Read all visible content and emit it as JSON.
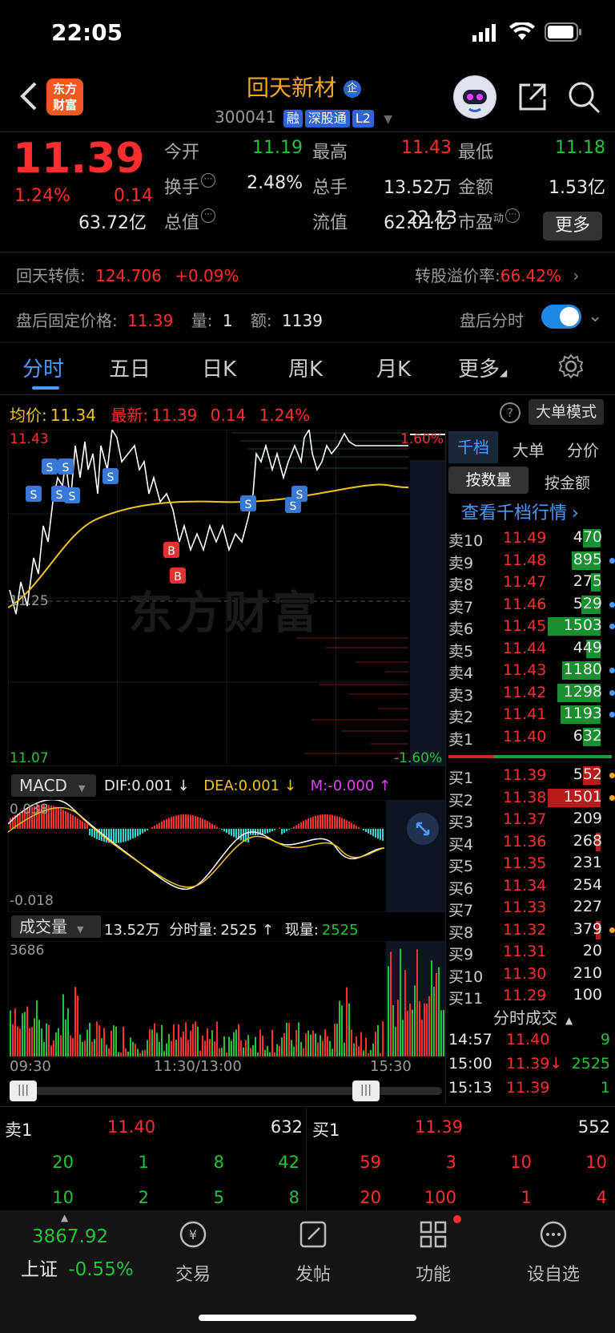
{
  "status_bar": {
    "time": "22:05"
  },
  "header": {
    "title": "回天新材",
    "title_badge": "企",
    "code": "300041",
    "tags": [
      "融",
      "深股通",
      "L2"
    ],
    "logo_line1": "东方",
    "logo_line2": "财富"
  },
  "quote": {
    "price": "11.39",
    "change_pct": "1.24%",
    "change": "0.14",
    "stats": [
      {
        "label": "今开",
        "value": "11.19",
        "color": "green"
      },
      {
        "label": "最高",
        "value": "11.43",
        "color": "red"
      },
      {
        "label": "最低",
        "value": "11.18",
        "color": "green"
      },
      {
        "label": "换手",
        "value": "2.48%",
        "color": "white"
      },
      {
        "label": "总手",
        "value": "13.52万",
        "color": "white"
      },
      {
        "label": "金额",
        "value": "1.53亿",
        "color": "white"
      },
      {
        "label": "总值",
        "value": "63.72亿",
        "color": "white"
      },
      {
        "label": "流值",
        "value": "62.01亿",
        "color": "white"
      },
      {
        "label": "市盈",
        "sup": "动",
        "value": "22.13",
        "color": "white"
      }
    ],
    "more_button": "更多"
  },
  "bond": {
    "name": "回天转债:",
    "price": "124.706",
    "change": "+0.09%",
    "premium_label": "转股溢价率:",
    "premium": "66.42%"
  },
  "after_hours": {
    "label": "盘后固定价格:",
    "price": "11.39",
    "vol_label": "量:",
    "vol": "1",
    "amt_label": "额:",
    "amt": "1139",
    "toggle_label": "盘后分时"
  },
  "tabs": [
    "分时",
    "五日",
    "日K",
    "周K",
    "月K",
    "更多"
  ],
  "chart_header": {
    "avg_label": "均价:",
    "avg": "11.34",
    "latest_label": "最新:",
    "latest": "11.39",
    "chg": "0.14",
    "pct": "1.24%",
    "mode_button": "大单模式"
  },
  "chart_labels": {
    "top_price": "11.43",
    "top_pct": "1.60%",
    "mid_price": "11.25",
    "bottom_price": "11.07",
    "bottom_pct": "-1.60%",
    "watermark": "东方财富"
  },
  "macd": {
    "name": "MACD",
    "dif": "DIF:0.001",
    "dea": "DEA:0.001",
    "m": "M:-0.000",
    "top": "0.038",
    "bottom": "-0.018"
  },
  "volume": {
    "name": "成交量",
    "total": "13.52万",
    "tick_label": "分时量:",
    "tick": "2525",
    "now_label": "现量:",
    "now": "2525",
    "max": "3686"
  },
  "time_axis": [
    "09:30",
    "11:30/13:00",
    "15:30"
  ],
  "order_book": {
    "tabs": [
      "千档",
      "大单",
      "分价"
    ],
    "subtabs": [
      "按数量",
      "按金额"
    ],
    "link": "查看千档行情",
    "asks": [
      {
        "label": "卖10",
        "price": "11.49",
        "vol": "470",
        "bar": 0.18
      },
      {
        "label": "卖9",
        "price": "11.48",
        "vol": "895",
        "bar": 0.3
      },
      {
        "label": "卖8",
        "price": "11.47",
        "vol": "275",
        "bar": 0.1
      },
      {
        "label": "卖7",
        "price": "11.46",
        "vol": "529",
        "bar": 0.2
      },
      {
        "label": "卖6",
        "price": "11.45",
        "vol": "1503",
        "bar": 0.55
      },
      {
        "label": "卖5",
        "price": "11.44",
        "vol": "449",
        "bar": 0.15
      },
      {
        "label": "卖4",
        "price": "11.43",
        "vol": "1180",
        "bar": 0.4
      },
      {
        "label": "卖3",
        "price": "11.42",
        "vol": "1298",
        "bar": 0.45
      },
      {
        "label": "卖2",
        "price": "11.41",
        "vol": "1193",
        "bar": 0.42
      },
      {
        "label": "卖1",
        "price": "11.40",
        "vol": "632",
        "bar": 0.18
      }
    ],
    "bids": [
      {
        "label": "买1",
        "price": "11.39",
        "vol": "552",
        "bar": 0.18
      },
      {
        "label": "买2",
        "price": "11.38",
        "vol": "1501",
        "bar": 0.55
      },
      {
        "label": "买3",
        "price": "11.37",
        "vol": "209",
        "bar": 0
      },
      {
        "label": "买4",
        "price": "11.36",
        "vol": "268",
        "bar": 0.05
      },
      {
        "label": "买5",
        "price": "11.35",
        "vol": "231",
        "bar": 0
      },
      {
        "label": "买6",
        "price": "11.34",
        "vol": "254",
        "bar": 0
      },
      {
        "label": "买7",
        "price": "11.33",
        "vol": "227",
        "bar": 0
      },
      {
        "label": "买8",
        "price": "11.32",
        "vol": "379",
        "bar": 0.05
      },
      {
        "label": "买9",
        "price": "11.31",
        "vol": "20",
        "bar": 0
      },
      {
        "label": "买10",
        "price": "11.30",
        "vol": "210",
        "bar": 0
      },
      {
        "label": "买11",
        "price": "11.29",
        "vol": "100",
        "bar": 0
      }
    ],
    "ticks_title": "分时成交",
    "ticks": [
      {
        "time": "14:57",
        "price": "11.40",
        "vol": "9"
      },
      {
        "time": "15:00",
        "price": "11.39↓",
        "vol": "2525"
      },
      {
        "time": "15:13",
        "price": "11.39",
        "vol": "1"
      }
    ]
  },
  "level2": {
    "sell_label": "卖1",
    "sell_price": "11.40",
    "sell_vol": "632",
    "buy_label": "买1",
    "buy_price": "11.39",
    "buy_vol": "552",
    "sell_row1": [
      "20",
      "1",
      "8",
      "42"
    ],
    "sell_row2": [
      "10",
      "2",
      "5",
      "8"
    ],
    "buy_row1": [
      "59",
      "3",
      "10",
      "10"
    ],
    "buy_row2": [
      "20",
      "100",
      "1",
      "4"
    ]
  },
  "bottom_nav": {
    "index_value": "3867.92",
    "index_name": "上证",
    "index_change": "-0.55%",
    "items": [
      "交易",
      "发帖",
      "功能",
      "设自选"
    ]
  }
}
